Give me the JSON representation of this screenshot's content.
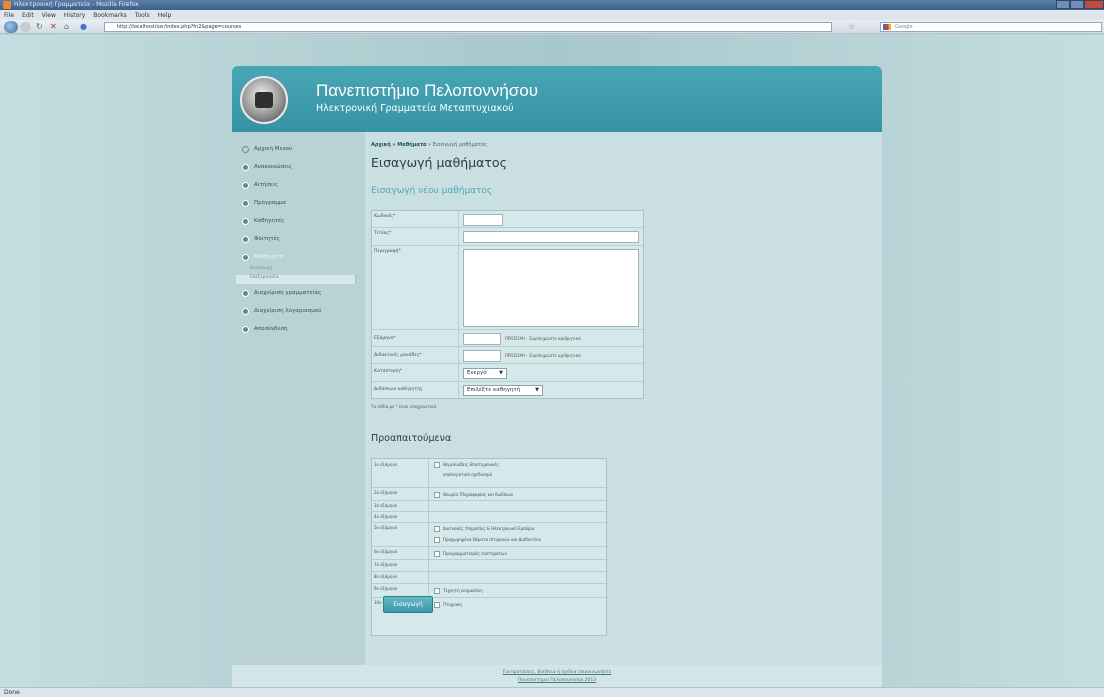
{
  "browser": {
    "title": "Ηλεκτρονική Γραμματεία - Mozilla Firefox",
    "menu": [
      "File",
      "Edit",
      "View",
      "History",
      "Bookmarks",
      "Tools",
      "Help"
    ],
    "address": "http://localhost/osr/index.php?fn2&page=courses",
    "search_placeholder": "Google",
    "status": "Done"
  },
  "header": {
    "university": "Πανεπιστήμιο Πελοποννήσου",
    "subtitle": "Ηλεκτρονική Γραμματεία Μεταπτυχιακού"
  },
  "sidebar": {
    "items": [
      {
        "label": "Αρχική Μενού"
      },
      {
        "label": "Ανακοινώσεις"
      },
      {
        "label": "Αιτήσεις"
      },
      {
        "label": "Πρόγραμμα"
      },
      {
        "label": "Καθηγητές"
      },
      {
        "label": "Φοιτητές"
      },
      {
        "label": "Μαθήματα"
      },
      {
        "label": "Διαχείριση γραμματείας"
      },
      {
        "label": "Διαχείριση λογαριασμού"
      },
      {
        "label": "Αποσύνδεση"
      }
    ],
    "subitems": [
      "Εισαγωγή",
      "Επεξεργασία"
    ]
  },
  "breadcrumb": {
    "home": "Αρχική",
    "section": "» Μαθήματα",
    "current": "» Εισαγωγή μαθήματος"
  },
  "page": {
    "title": "Εισαγωγή μαθήματος",
    "subtitle": "Εισαγωγή νέου μαθήματος",
    "required_note": "Τα πεδία με * είναι υποχρεωτικά",
    "prereq_title": "Προαπαιτούμενα",
    "submit": "Εισαγωγή"
  },
  "form": {
    "code": "Κωδικός*",
    "title": "Τίτλος*",
    "description": "Περιγραφή*",
    "semester": "Εξάμηνο*",
    "credits": "Διδακτικές μονάδες*",
    "hint": "ΠΡΟΣΟΧΗ - Συμπληρώστε αριθμητικά",
    "status": "Κατάσταση*",
    "status_value": "Ενεργό",
    "professor": "Διδάσκων καθηγητής",
    "professor_value": "Επιλέξτε καθηγητή"
  },
  "prereq": [
    {
      "sem": "1ο εξάμηνο",
      "courses": [
        "Θεμελιώδεις Επιστημονικές",
        "υπολογιστικό σχεδιασμό"
      ]
    },
    {
      "sem": "2ο εξάμηνο",
      "courses": [
        "Θεωρία Πληροφορίας και Κωδίκων"
      ]
    },
    {
      "sem": "3ο εξάμηνο",
      "courses": []
    },
    {
      "sem": "4ο εξάμηνο",
      "courses": []
    },
    {
      "sem": "5ο εξάμηνο",
      "courses": [
        "Δικτυακές Υπηρεσίες & Ηλεκτρονικό Εμπόριο",
        "Προχωρημένα Θέματα Ιστορικών και Διαδικτύου"
      ]
    },
    {
      "sem": "6ο εξάμηνο",
      "courses": [
        "Προγραμματισμός συστημάτων"
      ]
    },
    {
      "sem": "7ο εξάμηνο",
      "courses": []
    },
    {
      "sem": "8ο εξάμηνο",
      "courses": []
    },
    {
      "sem": "9ο εξάμηνο",
      "courses": [
        "Τεχνητή νοημοσύνη"
      ]
    },
    {
      "sem": "10ο εξάμηνο",
      "courses": [
        "Πτυχιακή"
      ]
    }
  ],
  "footer": {
    "line1": "Για προτάσεις, βοήθεια ή σχόλια επικοινωνήστε",
    "line2": "Πανεπιστήμιο Πελοποννήσου 2013"
  }
}
